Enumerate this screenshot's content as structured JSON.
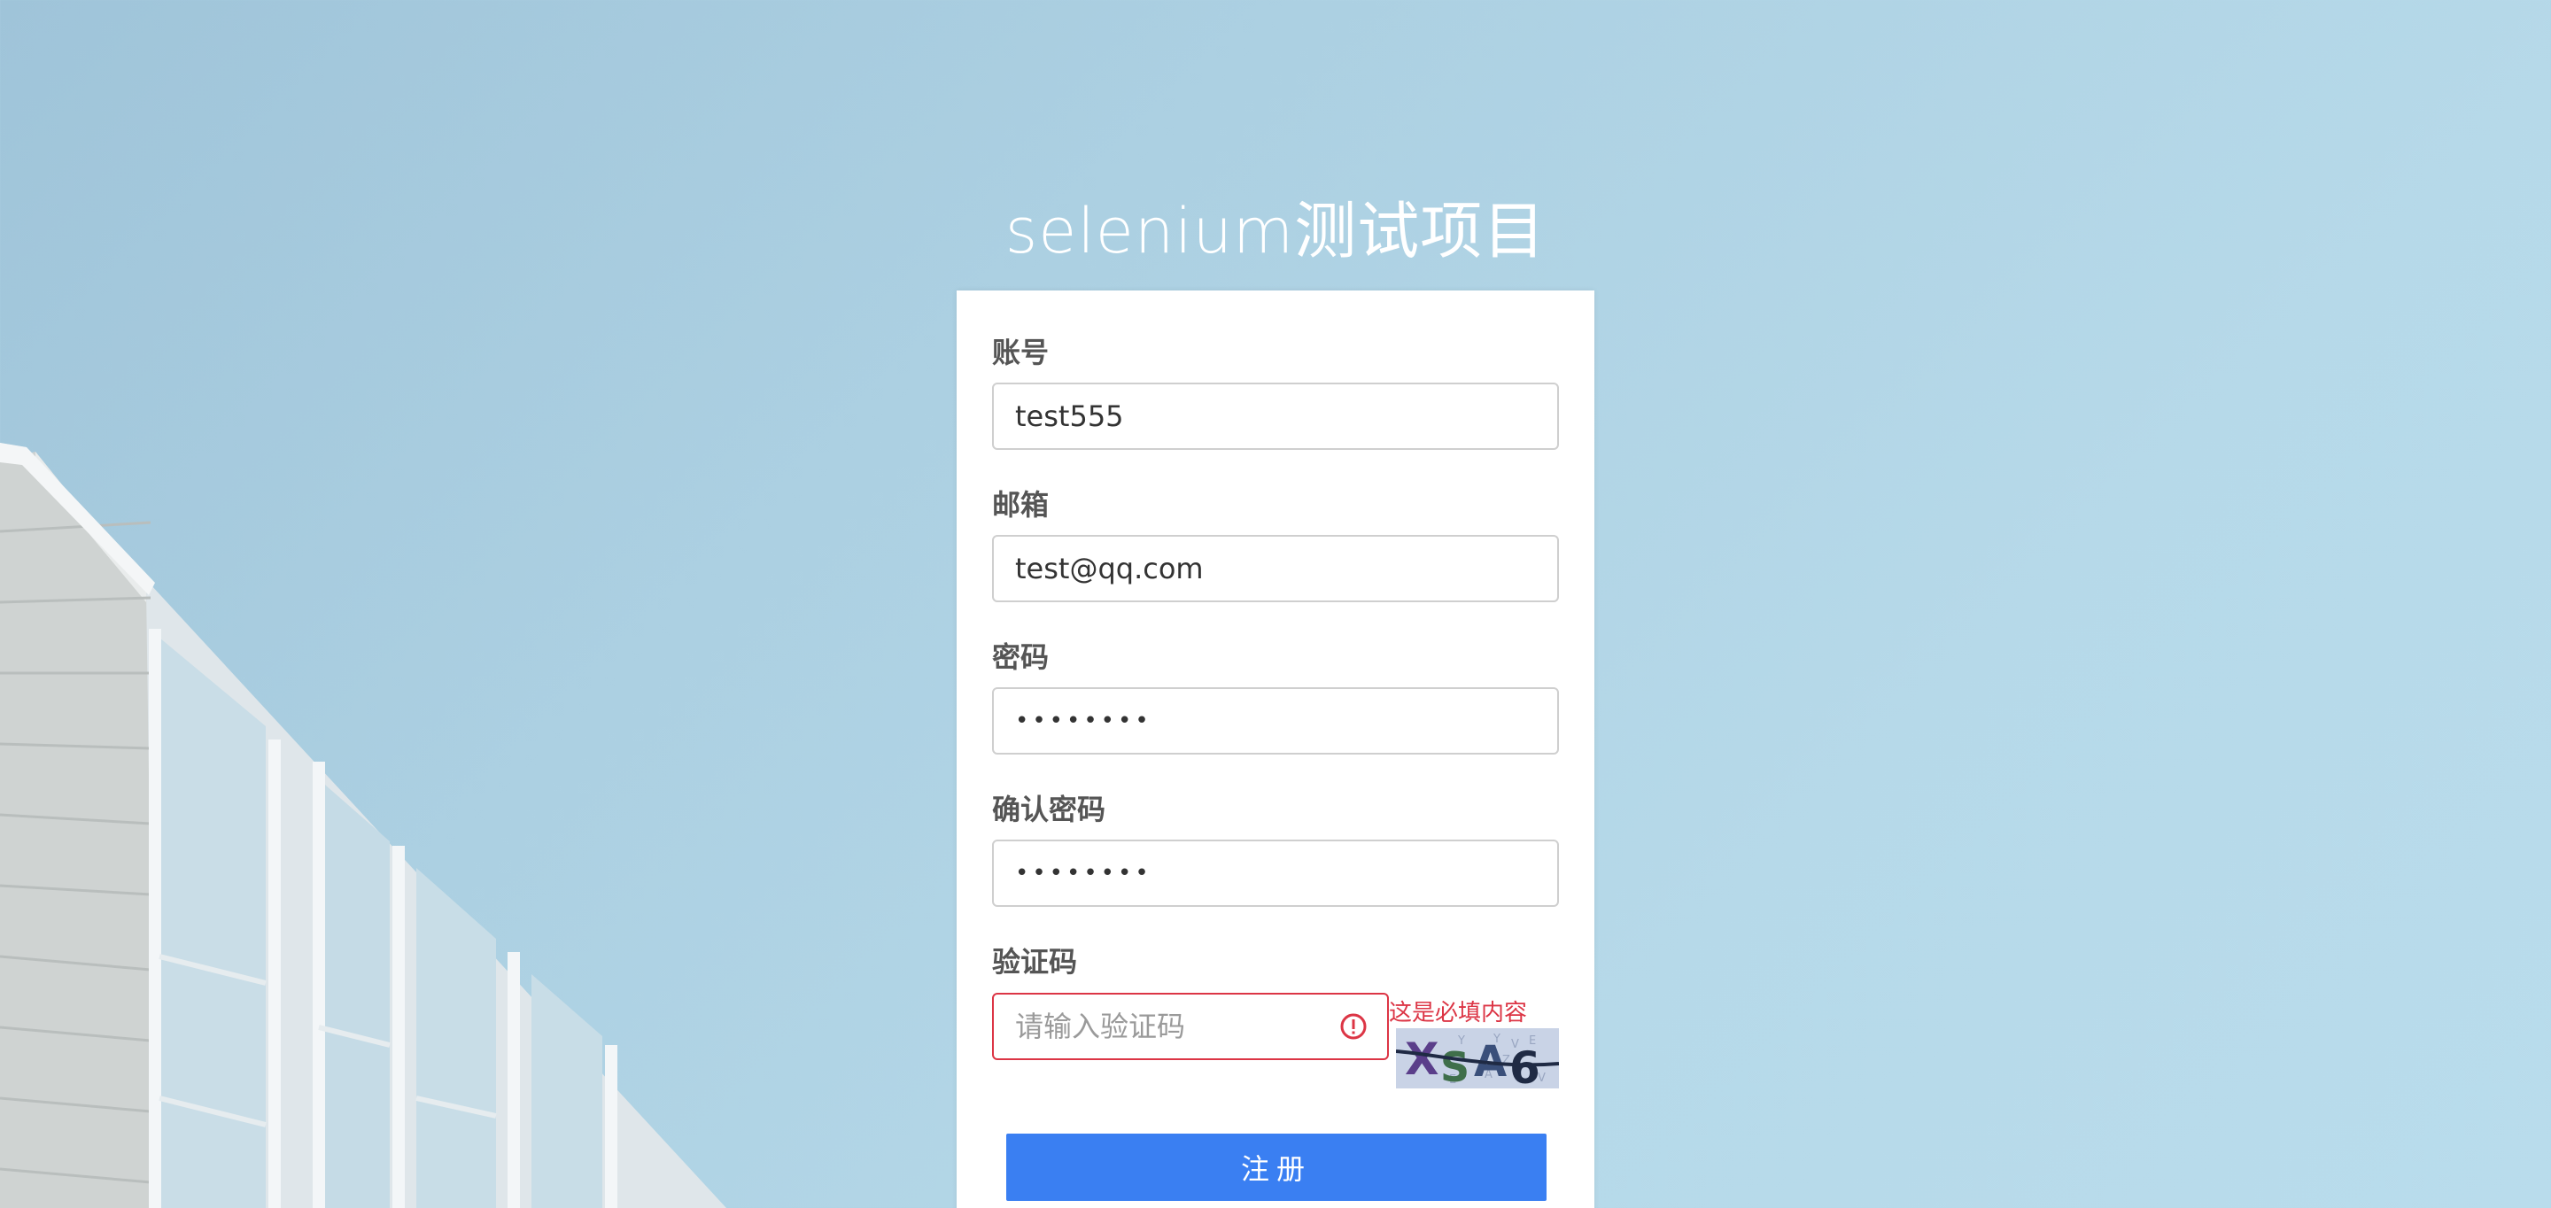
{
  "page": {
    "title": "selenium测试项目"
  },
  "form": {
    "account": {
      "label": "账号",
      "value": "test555"
    },
    "email": {
      "label": "邮箱",
      "value": "test@qq.com"
    },
    "password": {
      "label": "密码",
      "value": "••••••••"
    },
    "confirm_password": {
      "label": "确认密码",
      "value": "••••••••"
    },
    "captcha": {
      "label": "验证码",
      "value": "",
      "placeholder": "请输入验证码",
      "error": "这是必填内容",
      "image_text": "XSA6"
    },
    "submit_label": "注册"
  },
  "colors": {
    "primary": "#3a7ff2",
    "error": "#dc3545",
    "background_sky": "#acd0e2"
  },
  "icons": {
    "error": "exclamation-circle-icon"
  }
}
